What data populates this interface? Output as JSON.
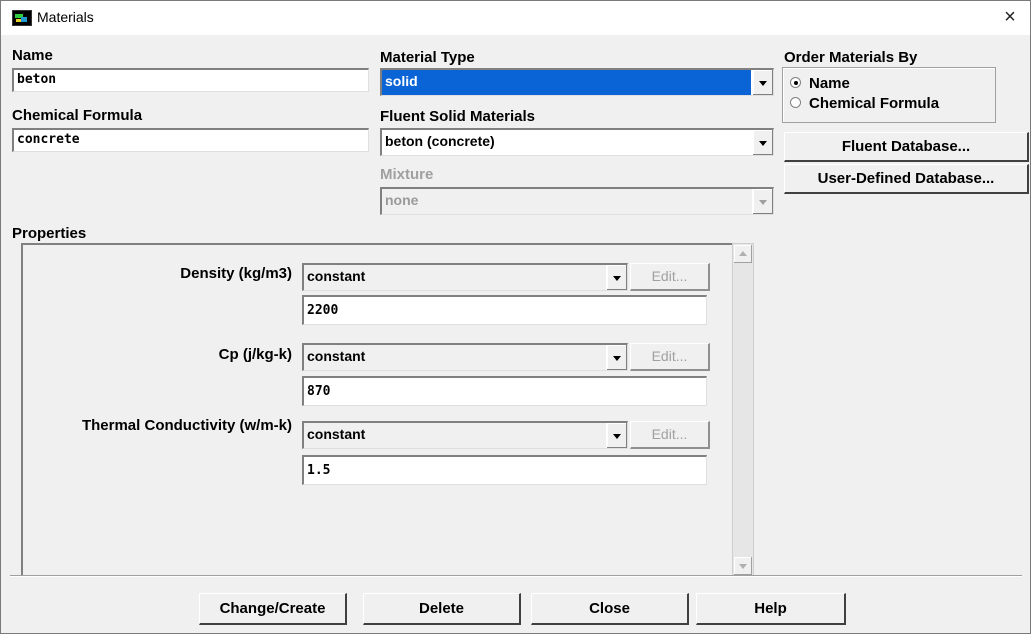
{
  "window": {
    "title": "Materials",
    "close_glyph": "×"
  },
  "name": {
    "label": "Name",
    "value": "beton"
  },
  "chemical_formula": {
    "label": "Chemical Formula",
    "value": "concrete"
  },
  "material_type": {
    "label": "Material Type",
    "value": "solid"
  },
  "fluent_solid_materials": {
    "label": "Fluent Solid Materials",
    "value": "beton (concrete)"
  },
  "mixture": {
    "label": "Mixture",
    "value": "none"
  },
  "order_by": {
    "label": "Order Materials By",
    "options": [
      {
        "label": "Name",
        "selected": true
      },
      {
        "label": "Chemical Formula",
        "selected": false
      }
    ]
  },
  "database_buttons": {
    "fluent": "Fluent Database...",
    "user_defined": "User-Defined Database..."
  },
  "properties": {
    "label": "Properties",
    "items": [
      {
        "label": "Density (kg/m3)",
        "method": "constant",
        "edit": "Edit...",
        "value": "2200"
      },
      {
        "label": "Cp (j/kg-k)",
        "method": "constant",
        "edit": "Edit...",
        "value": "870"
      },
      {
        "label": "Thermal Conductivity (w/m-k)",
        "method": "constant",
        "edit": "Edit...",
        "value": "1.5"
      }
    ]
  },
  "footer": {
    "change_create": "Change/Create",
    "delete": "Delete",
    "close": "Close",
    "help": "Help"
  },
  "colors": {
    "selection": "#0a64d6",
    "dialog_bg": "#f0f0f0"
  }
}
